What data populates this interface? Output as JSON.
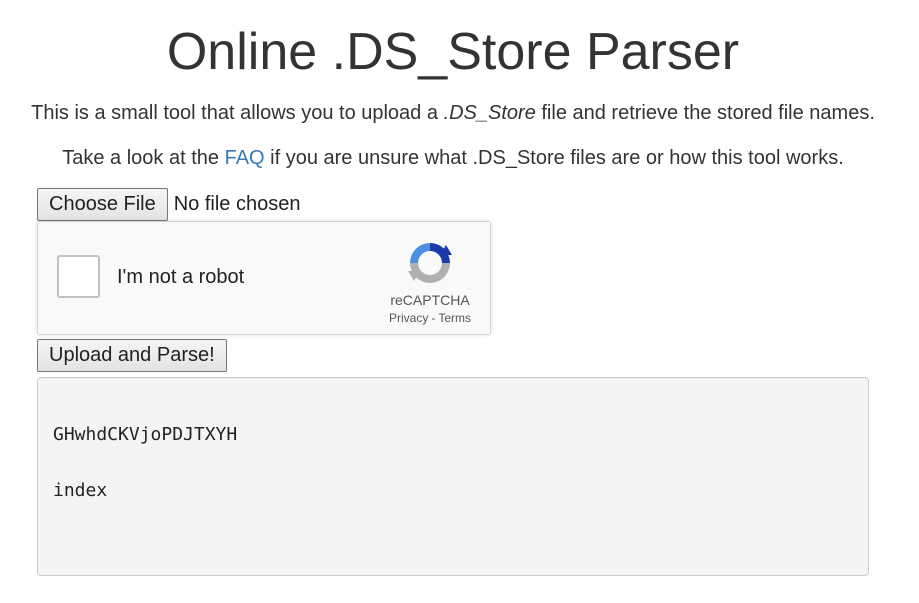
{
  "header": {
    "title": "Online .DS_Store Parser"
  },
  "intro": {
    "before": "This is a small tool that allows you to upload a ",
    "emphasis": ".DS_Store",
    "after": " file and retrieve the stored file names."
  },
  "faq": {
    "before": "Take a look at the ",
    "link_label": "FAQ",
    "after": " if you are unsure what .DS_Store files are or how this tool works."
  },
  "file_input": {
    "button_label": "Choose File",
    "status": "No file chosen"
  },
  "captcha": {
    "label": "I'm not a robot",
    "brand": "reCAPTCHA",
    "privacy_link": "Privacy",
    "separator": "-",
    "terms_link": "Terms",
    "icon": "recaptcha-logo-icon",
    "colors": {
      "blue": "#4a90e2",
      "dark_blue": "#1c3aa9",
      "gray": "#b0b0b0"
    }
  },
  "upload_button_label": "Upload and Parse!",
  "results": [
    "GHwhdCKVjoPDJTXYH",
    "index"
  ],
  "colors": {
    "link": "#337ab7",
    "text": "#333333",
    "result_bg": "#f4f4f4"
  }
}
